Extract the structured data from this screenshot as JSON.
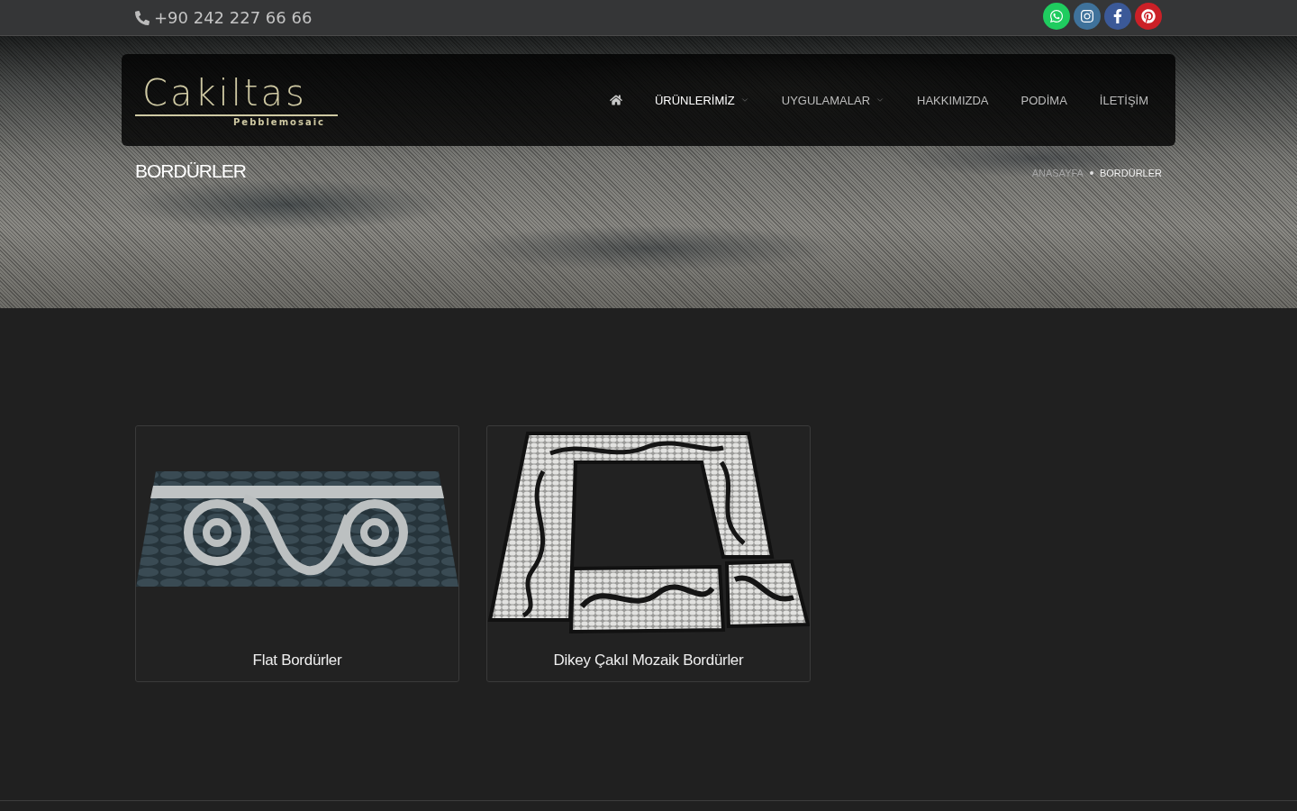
{
  "top_bar": {
    "phone": "+90 242 227 66 66",
    "social": [
      {
        "kind": "whatsapp",
        "color": "#1fcc5f"
      },
      {
        "kind": "instagram",
        "color": "#3f729b"
      },
      {
        "kind": "facebook",
        "color": "#3b5998"
      },
      {
        "kind": "pinterest",
        "color": "#cb2027"
      }
    ]
  },
  "header": {
    "logo": {
      "name": "Cakiltas",
      "tagline": "Pebblemosaic"
    },
    "nav": [
      {
        "kind": "home",
        "selected": false
      },
      {
        "kind": "link",
        "label": "ÜRÜNLERİMİZ",
        "selected": true,
        "dropdown": true
      },
      {
        "kind": "link",
        "label": "UYGULAMALAR",
        "selected": false,
        "dropdown": true
      },
      {
        "kind": "link",
        "label": "HAKKIMIZDA",
        "selected": false,
        "dropdown": false
      },
      {
        "kind": "link",
        "label": "PODİMA",
        "selected": false,
        "dropdown": false
      },
      {
        "kind": "link",
        "label": "İLETİŞİM",
        "selected": false,
        "dropdown": false
      }
    ]
  },
  "page_title": "BORDÜRLER",
  "breadcrumb": [
    {
      "label": "ANASAYFA",
      "current": false
    },
    {
      "label": "BORDÜRLER",
      "current": true
    }
  ],
  "products": [
    {
      "kind": "flat",
      "title": "Flat Bordürler"
    },
    {
      "kind": "vertical",
      "title": "Dikey Çakıl Mozaik Bordürler"
    }
  ]
}
